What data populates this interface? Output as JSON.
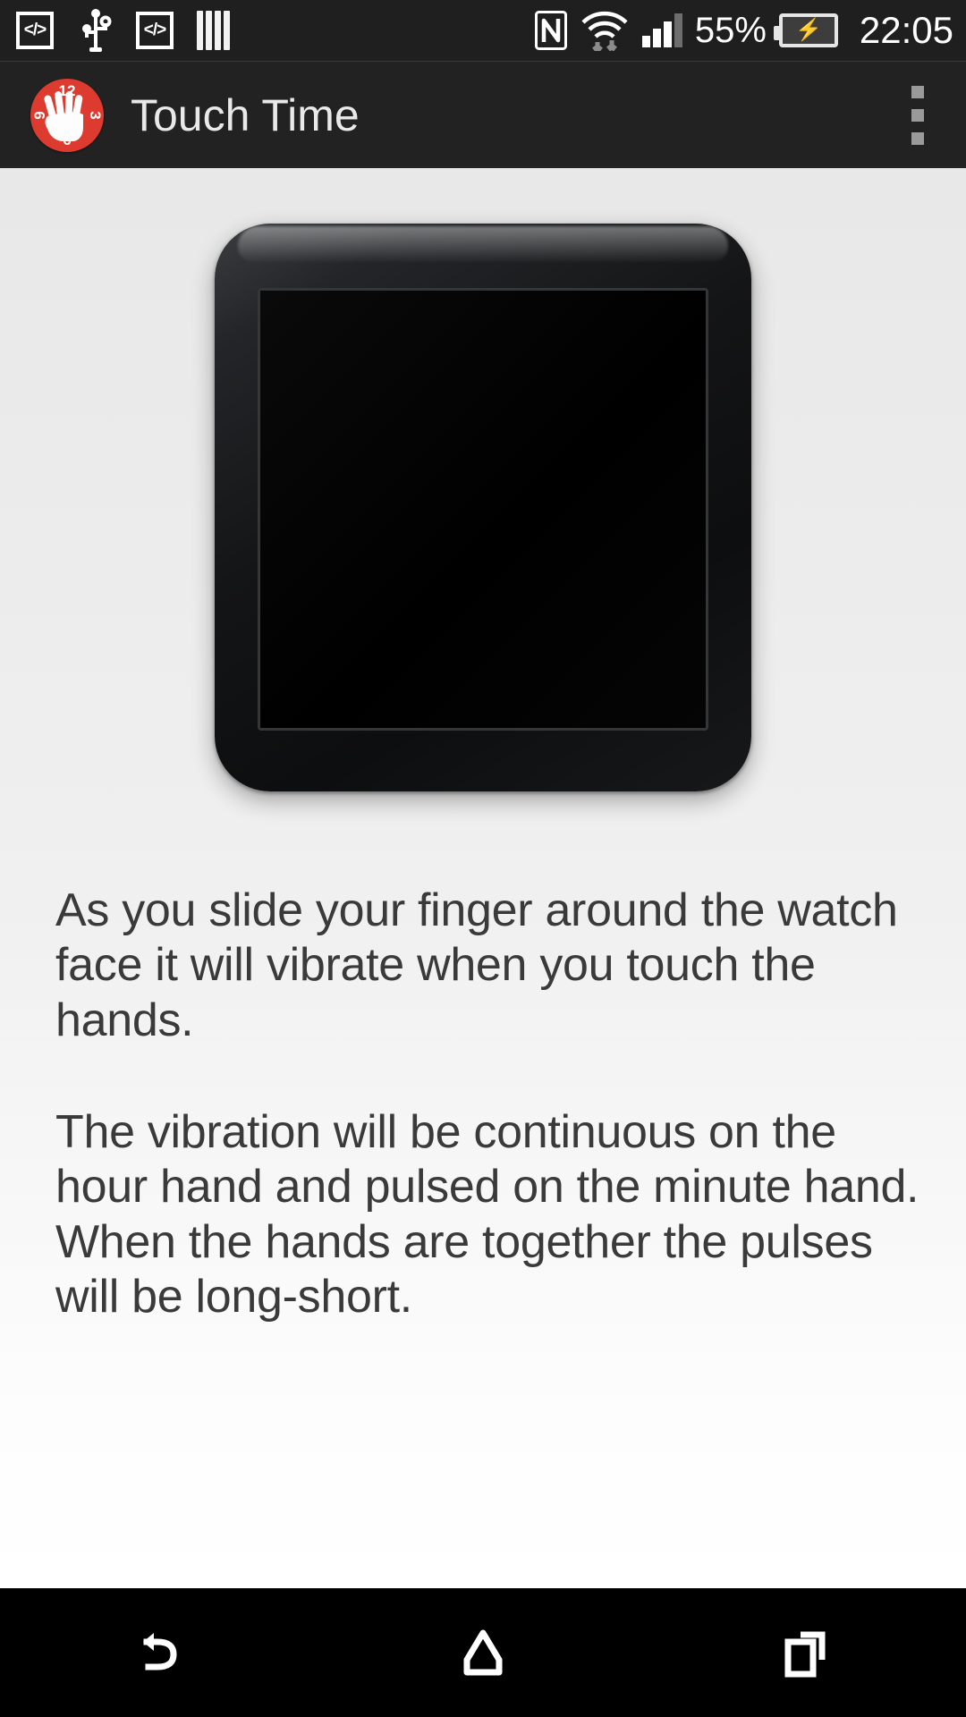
{
  "status_bar": {
    "icons": [
      {
        "name": "adb-over-network-icon",
        "glyph": "</>"
      },
      {
        "name": "usb-debugging-icon",
        "glyph": "usb"
      },
      {
        "name": "developer-mode-icon",
        "glyph": "</>"
      },
      {
        "name": "vertical-bars-icon",
        "glyph": "bars"
      },
      {
        "name": "nfc-icon",
        "glyph": "N"
      },
      {
        "name": "wifi-icon",
        "glyph": "wifi"
      },
      {
        "name": "cellular-signal-icon",
        "glyph": "signal"
      }
    ],
    "battery_percent": "55%",
    "battery_state": "charging",
    "time": "22:05"
  },
  "app_bar": {
    "title": "Touch Time",
    "icon": {
      "name": "touch-time-app-icon",
      "background_color": "#dd3b30",
      "clock_numbers": [
        "12",
        "3",
        "6",
        "9"
      ]
    },
    "overflow_menu_label": "More options"
  },
  "main": {
    "watch_image": {
      "name": "smartwatch-preview",
      "description": "Square Android Wear smartwatch with blank black screen"
    },
    "paragraphs": [
      "As you slide your finger around the watch face it will vibrate when you touch the hands.",
      "The vibration will be continuous on the hour hand and pulsed on the minute hand. When the hands are together the pulses will be long-short."
    ]
  },
  "nav_bar": {
    "buttons": [
      {
        "name": "back-button",
        "label": "Back"
      },
      {
        "name": "home-button",
        "label": "Home"
      },
      {
        "name": "recents-button",
        "label": "Recent apps"
      }
    ]
  },
  "colors": {
    "status_bar_bg": "#1f1f1f",
    "app_bar_bg": "#222222",
    "accent": "#dd3b30",
    "content_bg": "#ececec",
    "text": "#3a3a3a",
    "nav_bar_bg": "#000000"
  }
}
